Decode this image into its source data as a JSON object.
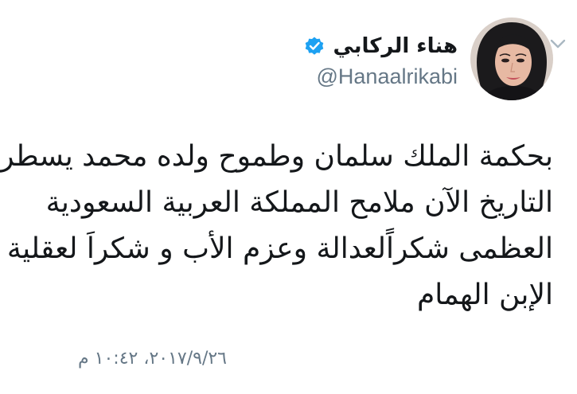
{
  "tweet": {
    "author": {
      "display_name": "هناء الركابي",
      "handle": "@Hanaalrikabi",
      "verified": true,
      "verified_icon": "verified-badge-icon",
      "avatar": "profile-photo"
    },
    "text_lines": [
      "بحكمة الملك سلمان وطموح ولده محمد يسطر",
      "التاريخ الآن ملامح المملكة العربية السعودية",
      "العظمى شكراًلعدالة وعزم الأب و شكراَ لعقلية",
      "الإبن الهمام"
    ],
    "timestamp": "٢٠١٧/٩/٢٦، ١٠:٤٢ م",
    "menu_icon": "chevron-down-icon"
  },
  "colors": {
    "text": "#14171a",
    "secondary": "#657786",
    "verified_blue": "#1da1f2",
    "chevron": "#aab8c2"
  }
}
